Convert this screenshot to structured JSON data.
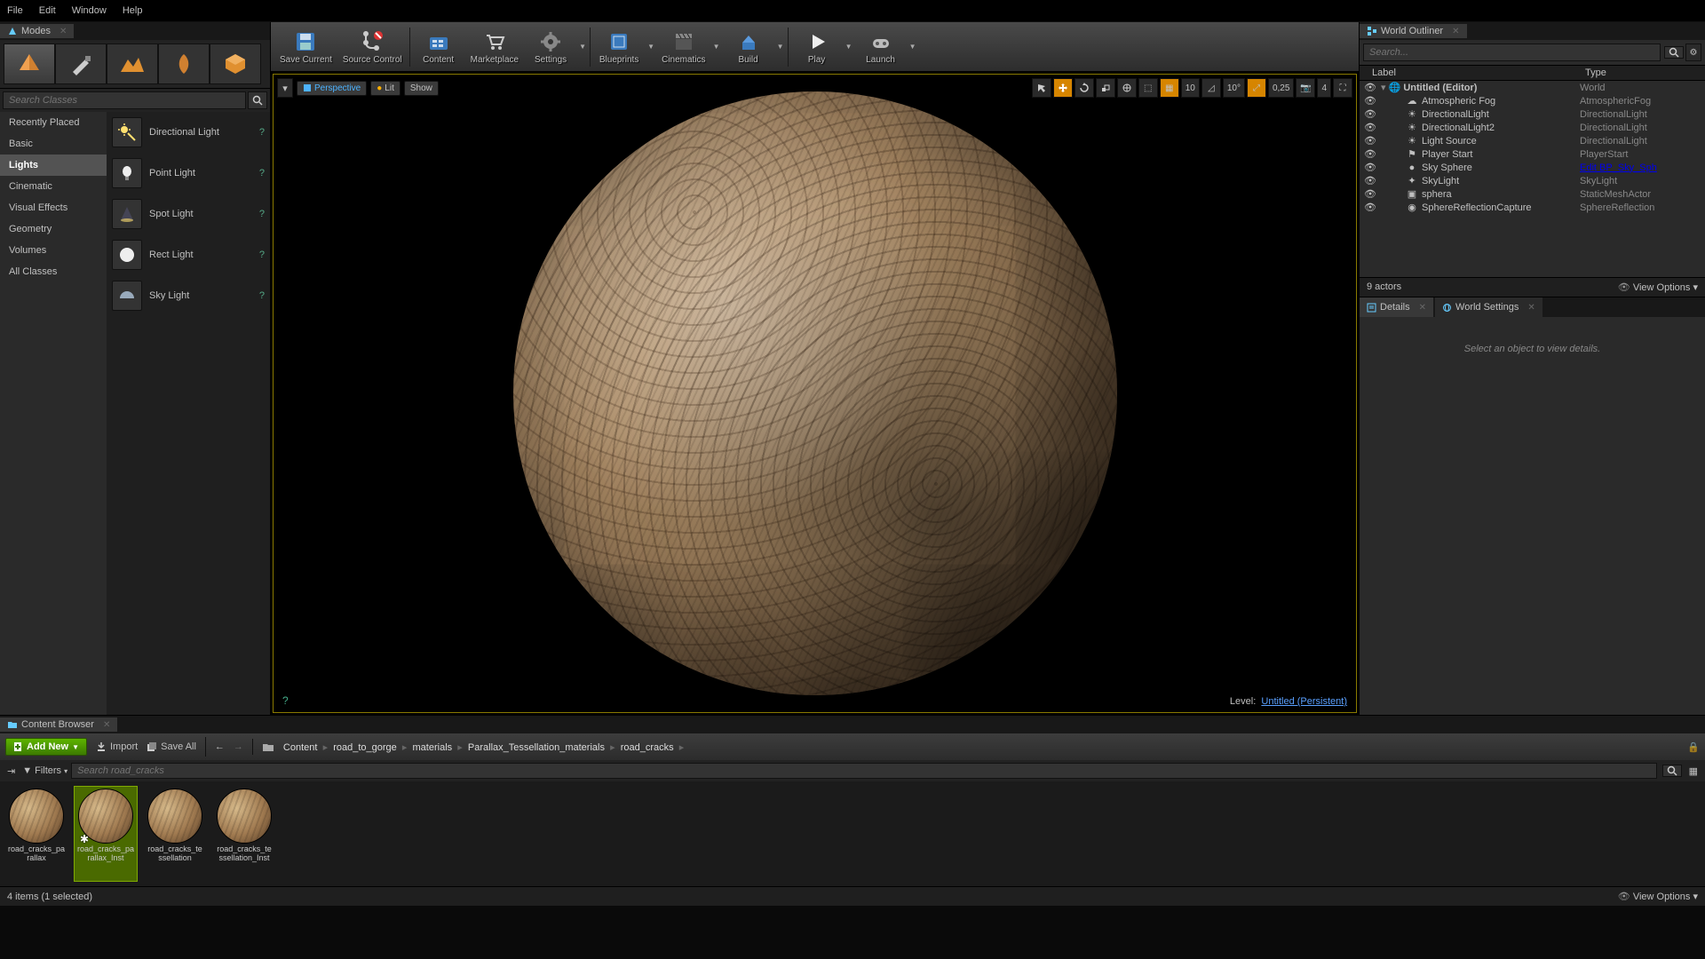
{
  "menu": {
    "file": "File",
    "edit": "Edit",
    "window": "Window",
    "help": "Help"
  },
  "modes_tab": "Modes",
  "search_classes_placeholder": "Search Classes",
  "mode_categories": [
    "Recently Placed",
    "Basic",
    "Lights",
    "Cinematic",
    "Visual Effects",
    "Geometry",
    "Volumes",
    "All Classes"
  ],
  "mode_active_cat": 2,
  "light_items": [
    "Directional Light",
    "Point Light",
    "Spot Light",
    "Rect Light",
    "Sky Light"
  ],
  "toolbar": {
    "save": "Save Current",
    "source_control": "Source Control",
    "content": "Content",
    "marketplace": "Marketplace",
    "settings": "Settings",
    "blueprints": "Blueprints",
    "cinematics": "Cinematics",
    "build": "Build",
    "play": "Play",
    "launch": "Launch"
  },
  "viewport": {
    "perspective": "Perspective",
    "lit": "Lit",
    "show": "Show",
    "snap1": "10",
    "snap2": "10°",
    "snap3": "0,25",
    "cam_speed": "4",
    "level_label": "Level:",
    "level_name": "Untitled (Persistent)"
  },
  "outliner": {
    "tab": "World Outliner",
    "search_placeholder": "Search...",
    "col_label": "Label",
    "col_type": "Type",
    "root": {
      "name": "Untitled (Editor)",
      "type": "World"
    },
    "rows": [
      {
        "name": "Atmospheric Fog",
        "type": "AtmosphericFog",
        "icon": "cloud"
      },
      {
        "name": "DirectionalLight",
        "type": "DirectionalLight",
        "icon": "sun"
      },
      {
        "name": "DirectionalLight2",
        "type": "DirectionalLight",
        "icon": "sun"
      },
      {
        "name": "Light Source",
        "type": "DirectionalLight",
        "icon": "sun"
      },
      {
        "name": "Player Start",
        "type": "PlayerStart",
        "icon": "flag"
      },
      {
        "name": "Sky Sphere",
        "type": "Edit BP_Sky_Sph",
        "icon": "sphere",
        "link": true
      },
      {
        "name": "SkyLight",
        "type": "SkyLight",
        "icon": "light"
      },
      {
        "name": "sphera",
        "type": "StaticMeshActor",
        "icon": "mesh"
      },
      {
        "name": "SphereReflectionCapture",
        "type": "SphereReflection",
        "icon": "reflect"
      }
    ],
    "count": "9 actors",
    "view_options": "View Options"
  },
  "details": {
    "tab1": "Details",
    "tab2": "World Settings",
    "empty": "Select an object to view details."
  },
  "content_browser": {
    "tab": "Content Browser",
    "add_new": "Add New",
    "import": "Import",
    "save_all": "Save All",
    "breadcrumbs": [
      "Content",
      "road_to_gorge",
      "materials",
      "Parallax_Tessellation_materials",
      "road_cracks"
    ],
    "filters": "Filters",
    "search_placeholder": "Search road_cracks",
    "assets": [
      {
        "name": "road_cracks_parallax"
      },
      {
        "name": "road_cracks_parallax_Inst",
        "selected": true,
        "star": true
      },
      {
        "name": "road_cracks_tessellation"
      },
      {
        "name": "road_cracks_tessellation_Inst"
      }
    ],
    "status": "4 items (1 selected)",
    "view_options": "View Options"
  }
}
